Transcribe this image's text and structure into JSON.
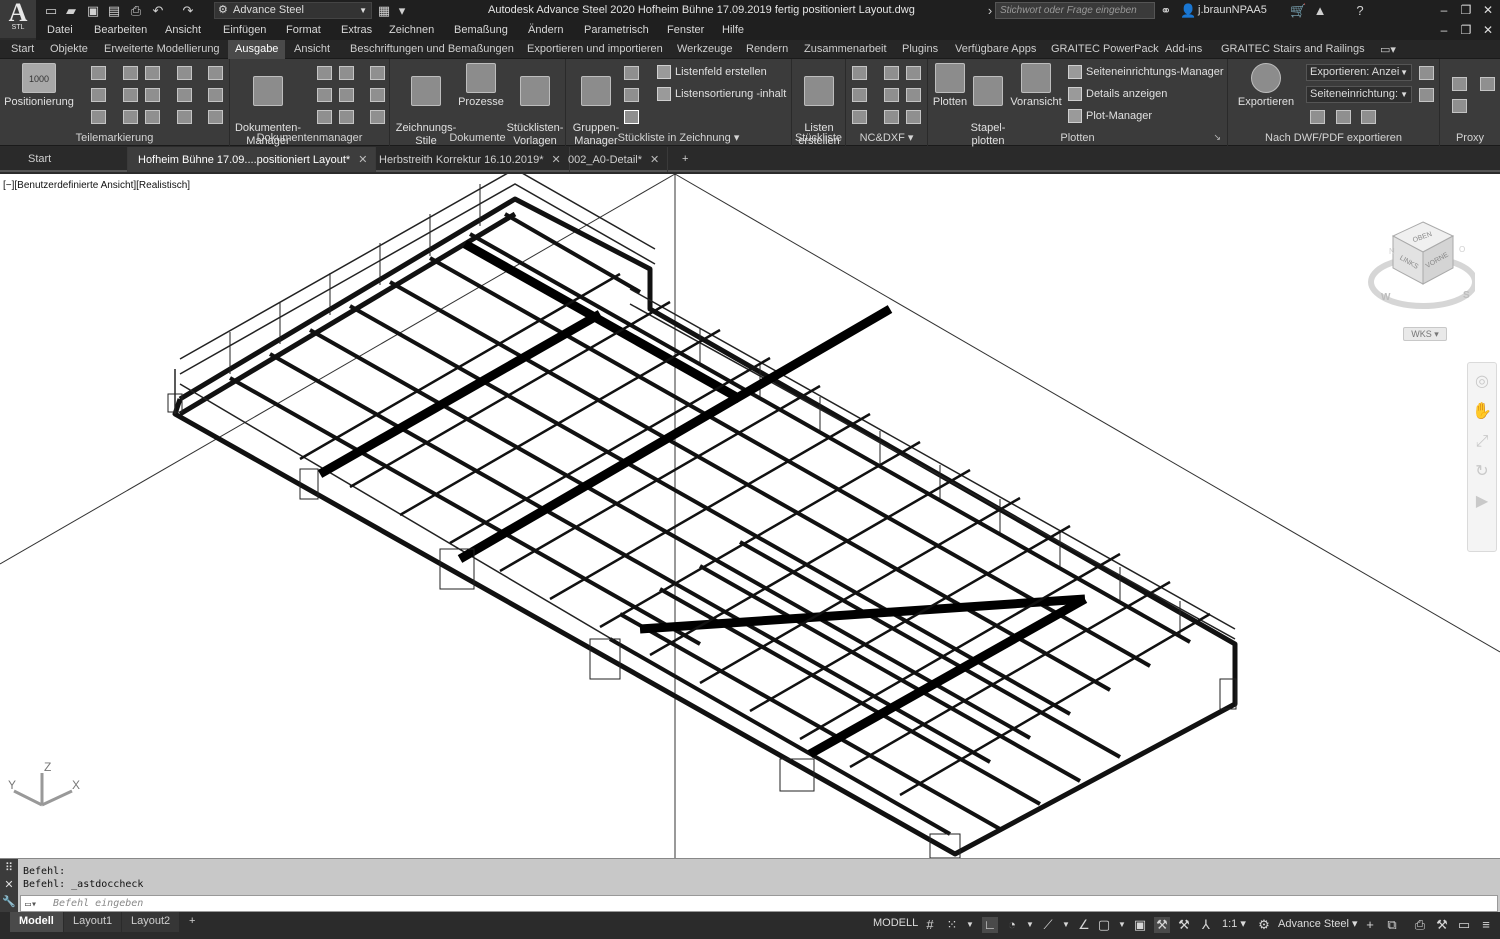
{
  "app": {
    "logo_big": "A",
    "logo_small": "STL",
    "workspace": "Advance Steel",
    "window_title": "Autodesk Advance Steel 2020   Hofheim Bühne 17.09.2019 fertig positioniert Layout.dwg",
    "search_placeholder": "Stichwort oder Frage eingeben",
    "user": "j.braunNPAA5"
  },
  "menu": [
    "Datei",
    "Bearbeiten",
    "Ansicht",
    "Einfügen",
    "Format",
    "Extras",
    "Zeichnen",
    "Bemaßung",
    "Ändern",
    "Parametrisch",
    "Fenster",
    "Hilfe"
  ],
  "ribbon_tabs": [
    "Start",
    "Objekte",
    "Erweiterte Modellierung",
    "Ausgabe",
    "Ansicht",
    "Beschriftungen und Bemaßungen",
    "Exportieren und importieren",
    "Werkzeuge",
    "Rendern",
    "Zusammenarbeit",
    "Plugins",
    "Verfügbare Apps",
    "GRAITEC PowerPack",
    "Add-ins",
    "GRAITEC Stairs and Railings"
  ],
  "ribbon": {
    "groups": {
      "teilemarkierung": "Teilemarkierung",
      "dokumentenmanager": "Dokumentenmanager",
      "dokumente": "Dokumente",
      "stueckliste_zeichnung": "Stückliste in Zeichnung",
      "stueckliste": "Stückliste",
      "ncdxf": "NC&DXF",
      "plotten": "Plotten",
      "dwfpdf": "Nach DWF/PDF exportieren",
      "proxy": "Proxy"
    },
    "buttons": {
      "positionierung": "Positionierung",
      "positionierung_icon_text": "1000",
      "dokumenten_manager": "Dokumenten-\nManager",
      "zeichnungs_stile": "Zeichnungs-\nStile",
      "prozesse": "Prozesse",
      "stuecklisten_vorlagen": "Stücklisten-\nVorlagen",
      "gruppen_manager": "Gruppen-\nManager",
      "listenfeld_erstellen": "Listenfeld erstellen",
      "listensortierung": "Listensortierung -inhalt",
      "listen_erstellen": "Listen\nerstellen",
      "plotten": "Plotten",
      "stapel_plotten": "Stapel-\nplotten",
      "voransicht": "Voransicht",
      "seiteneinrichtungs_manager": "Seiteneinrichtungs-Manager",
      "details_anzeigen": "Details anzeigen",
      "plot_manager": "Plot-Manager",
      "exportieren": "Exportieren"
    },
    "combos": {
      "exportieren_anzeige": "Exportieren: Anzei",
      "seiteneinrichtung": "Seiteneinrichtung:"
    }
  },
  "file_tabs": [
    {
      "label": "Start",
      "active": false,
      "closable": false
    },
    {
      "label": "Hofheim Bühne 17.09....positioniert Layout*",
      "active": true,
      "closable": true
    },
    {
      "label": "Herbstreith Korrektur 16.10.2019*",
      "active": false,
      "closable": true
    },
    {
      "label": "002_A0-Detail*",
      "active": false,
      "closable": true
    }
  ],
  "viewport": {
    "label": "[−][Benutzerdefinierte Ansicht][Realistisch]",
    "viewcube_faces": {
      "top": "OBEN",
      "left": "LINKS",
      "front": "VORNE"
    },
    "compass": {
      "w": "W",
      "s": "S",
      "n": "N",
      "o": "O"
    },
    "wcs": "WKS",
    "ucs": {
      "x": "X",
      "y": "Y",
      "z": "Z"
    }
  },
  "command": {
    "history": [
      "Befehl:",
      "Befehl: _astdoccheck"
    ],
    "placeholder": "Befehl eingeben"
  },
  "status": {
    "layout_tabs": [
      {
        "label": "Modell",
        "active": true
      },
      {
        "label": "Layout1",
        "active": false
      },
      {
        "label": "Layout2",
        "active": false
      }
    ],
    "add_tab": "+",
    "space": "MODELL",
    "scale": "1:1",
    "workspace": "Advance Steel"
  }
}
